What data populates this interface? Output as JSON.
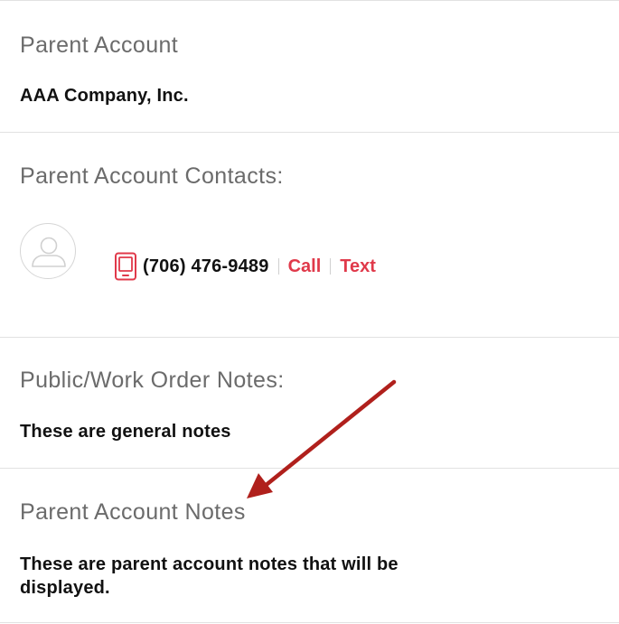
{
  "sections": {
    "parent_account": {
      "label": "Parent Account",
      "value": "AAA Company, Inc."
    },
    "parent_account_contacts": {
      "label": "Parent Account Contacts:",
      "contact": {
        "avatar_icon": "user-avatar-icon",
        "phone_icon": "mobile-phone-icon",
        "phone_number": "(706) 476-9489",
        "call_label": "Call",
        "text_label": "Text"
      }
    },
    "public_work_order_notes": {
      "label": "Public/Work Order Notes:",
      "value": "These are general notes"
    },
    "parent_account_notes": {
      "label": "Parent Account Notes",
      "value": "These are parent account notes that will be displayed."
    }
  },
  "colors": {
    "accent": "#e0394a",
    "label_text": "#6b6b6b",
    "value_text": "#111111",
    "divider": "#e2e2e2",
    "annotation_arrow": "#b0201c"
  }
}
